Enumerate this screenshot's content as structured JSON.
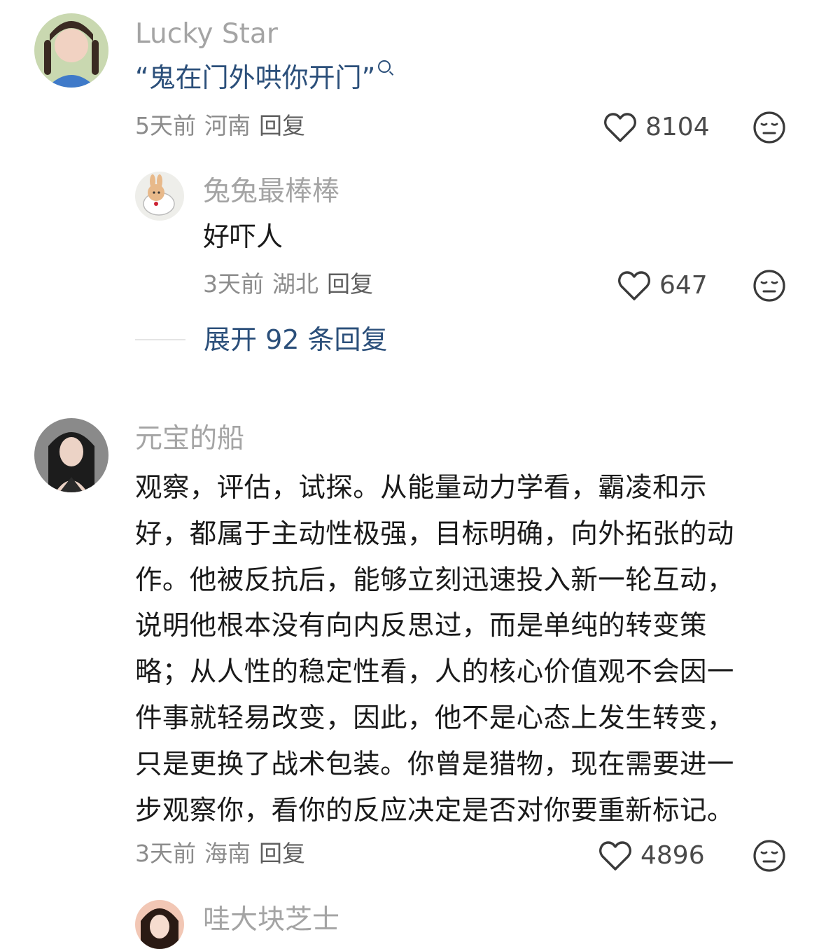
{
  "comments": [
    {
      "user": "Lucky Star",
      "text": "“鬼在门外哄你开门”",
      "time": "5天前",
      "location": "河南",
      "reply_label": "回复",
      "likes": "8104",
      "search_glyph": "search-icon",
      "replies": [
        {
          "user": "兔兔最棒棒",
          "text": "好吓人",
          "time": "3天前",
          "location": "湖北",
          "reply_label": "回复",
          "likes": "647"
        }
      ],
      "expand_label": "展开 92 条回复"
    },
    {
      "user": "元宝的船",
      "text_lines": [
        "观察，评估，试探。从能量动力学看，霸凌和示",
        "好，都属于主动性极强，目标明确，向外拓张的动",
        "作。他被反抗后，能够立刻迅速投入新一轮互动，",
        "说明他根本没有向内反思过，而是单纯的转变策",
        "略；从人性的稳定性看，人的核心价值观不会因一",
        "件事就轻易改变，因此，他不是心态上发生转变，",
        "只是更换了战术包装。你曾是猎物，现在需要进一",
        "步观察你，看你的反应决定是否对你要重新标记。"
      ],
      "time": "3天前",
      "location": "海南",
      "reply_label": "回复",
      "likes": "4896"
    },
    {
      "user": "哇大块芝士"
    }
  ],
  "icons": {
    "like": "heart-outline-icon",
    "dislike": "meh-face-icon"
  },
  "colors": {
    "username": "#a4a4a4",
    "link": "#2b4f7a",
    "meta": "#8c8c8c"
  }
}
